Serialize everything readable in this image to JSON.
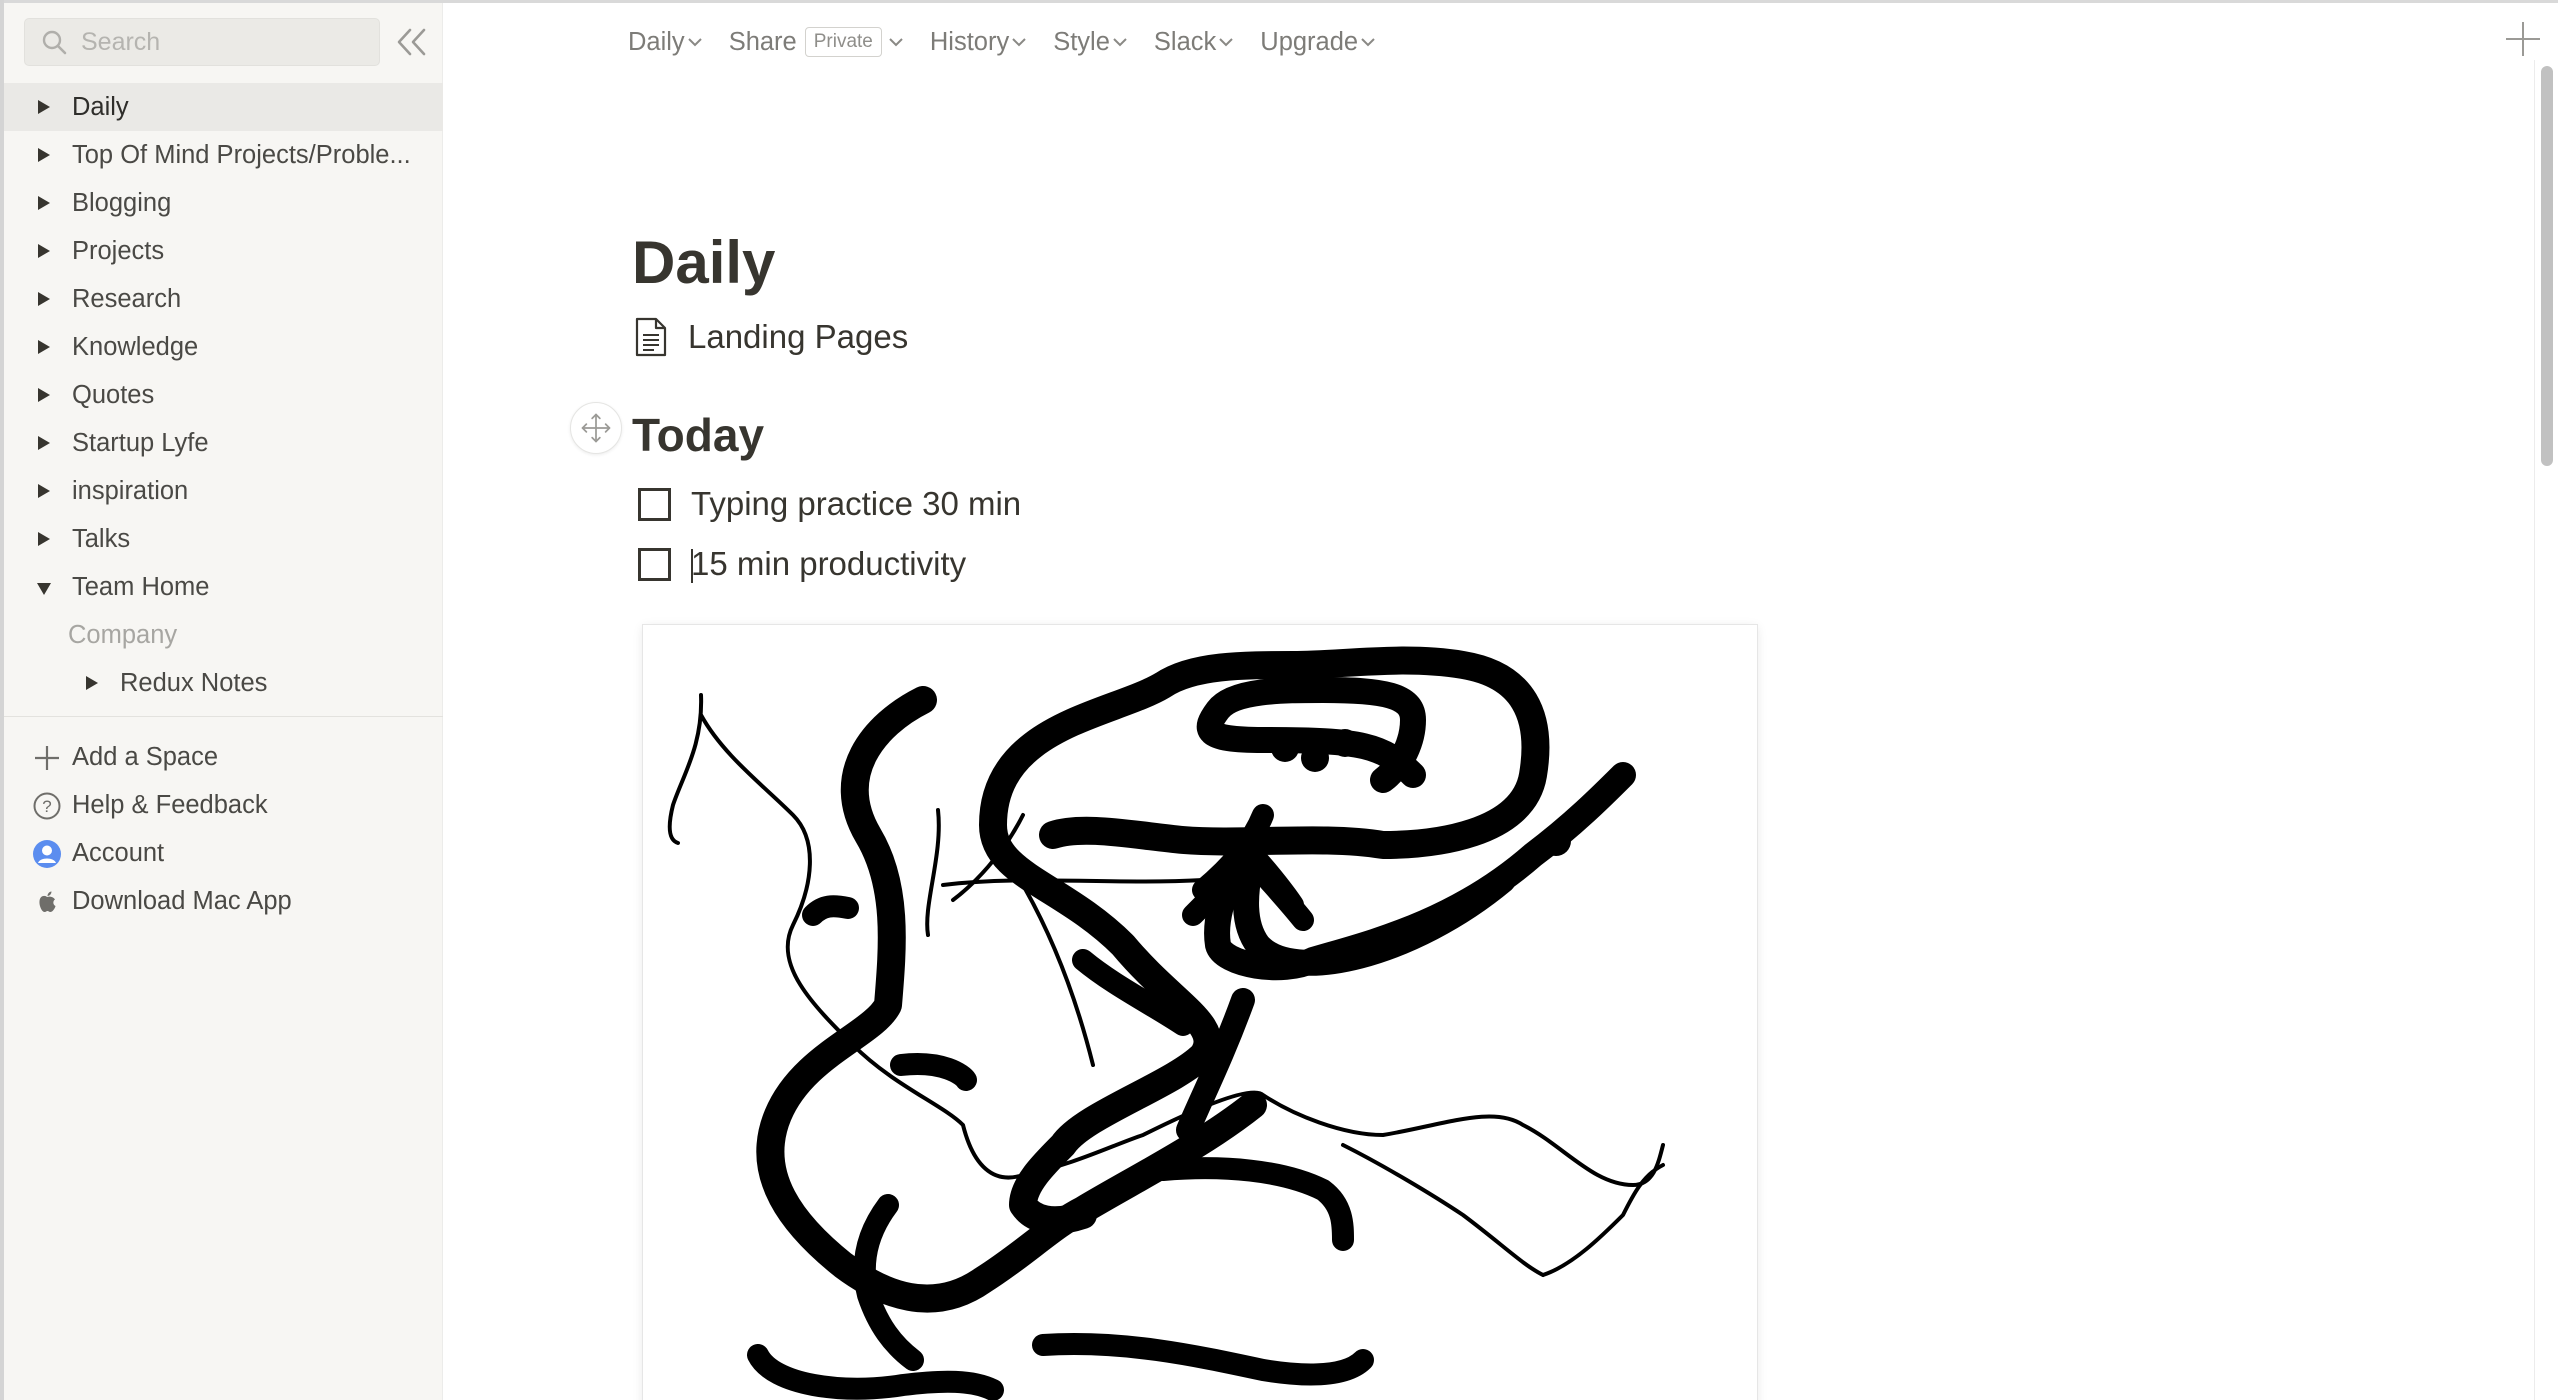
{
  "sidebar": {
    "search_placeholder": "Search",
    "tree": [
      {
        "label": "Daily",
        "state": "collapsed",
        "active": true
      },
      {
        "label": "Top Of Mind Projects/Proble...",
        "state": "collapsed"
      },
      {
        "label": "Blogging",
        "state": "collapsed"
      },
      {
        "label": "Projects",
        "state": "collapsed"
      },
      {
        "label": "Research",
        "state": "collapsed"
      },
      {
        "label": "Knowledge",
        "state": "collapsed"
      },
      {
        "label": "Quotes",
        "state": "collapsed"
      },
      {
        "label": "Startup Lyfe",
        "state": "collapsed"
      },
      {
        "label": "inspiration",
        "state": "collapsed"
      },
      {
        "label": "Talks",
        "state": "collapsed"
      },
      {
        "label": "Team Home",
        "state": "expanded"
      },
      {
        "label": "Company"
      },
      {
        "label": "Redux Notes",
        "state": "collapsed"
      }
    ],
    "footer": [
      {
        "label": "Add a Space",
        "icon": "plus-icon"
      },
      {
        "label": "Help & Feedback",
        "icon": "help-circle-icon"
      },
      {
        "label": "Account",
        "icon": "user-avatar-icon"
      },
      {
        "label": "Download Mac App",
        "icon": "apple-icon"
      }
    ]
  },
  "topbar": {
    "daily": "Daily",
    "share": "Share",
    "share_badge": "Private",
    "history": "History",
    "style": "Style",
    "slack": "Slack",
    "upgrade": "Upgrade"
  },
  "document": {
    "title": "Daily",
    "link": "Landing Pages",
    "heading": "Today",
    "todos": [
      {
        "text": "Typing practice 30 min",
        "checked": false
      },
      {
        "text": "15 min productivity",
        "checked": false
      }
    ]
  },
  "colors": {
    "sidebar_bg": "#f7f6f3",
    "active_item_bg": "#eae9e6",
    "text": "#37352f",
    "muted_text": "#7d7c78",
    "account_blue": "#4a86e8"
  }
}
